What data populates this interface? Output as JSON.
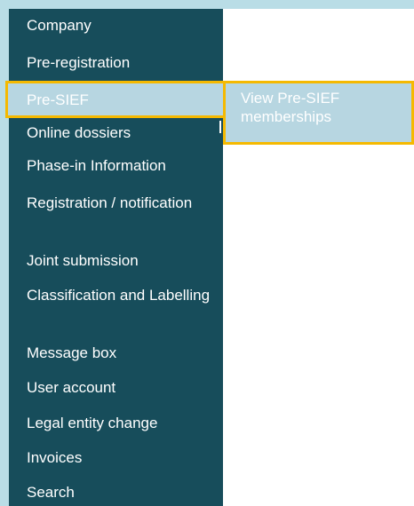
{
  "sidebar": {
    "items": [
      {
        "label": "Company"
      },
      {
        "label": "Pre-registration"
      },
      {
        "label": "Pre-SIEF"
      },
      {
        "label": "Online dossiers"
      },
      {
        "label": "Phase-in Information"
      },
      {
        "label": "Registration / notification"
      },
      {
        "label": "Joint submission"
      },
      {
        "label": "Classification and Labelling"
      },
      {
        "label": "Message box"
      },
      {
        "label": "User account"
      },
      {
        "label": "Legal entity change"
      },
      {
        "label": "Invoices"
      },
      {
        "label": "Search"
      }
    ],
    "active_item": "Pre-SIEF"
  },
  "submenu": {
    "items": [
      {
        "label": "View Pre-SIEF memberships"
      }
    ]
  },
  "colors": {
    "page_background": "#b9dde6",
    "sidebar_background": "#174d5b",
    "active_background": "#b7d6e1",
    "highlight_border": "#f5b900",
    "text": "#ffffff"
  }
}
